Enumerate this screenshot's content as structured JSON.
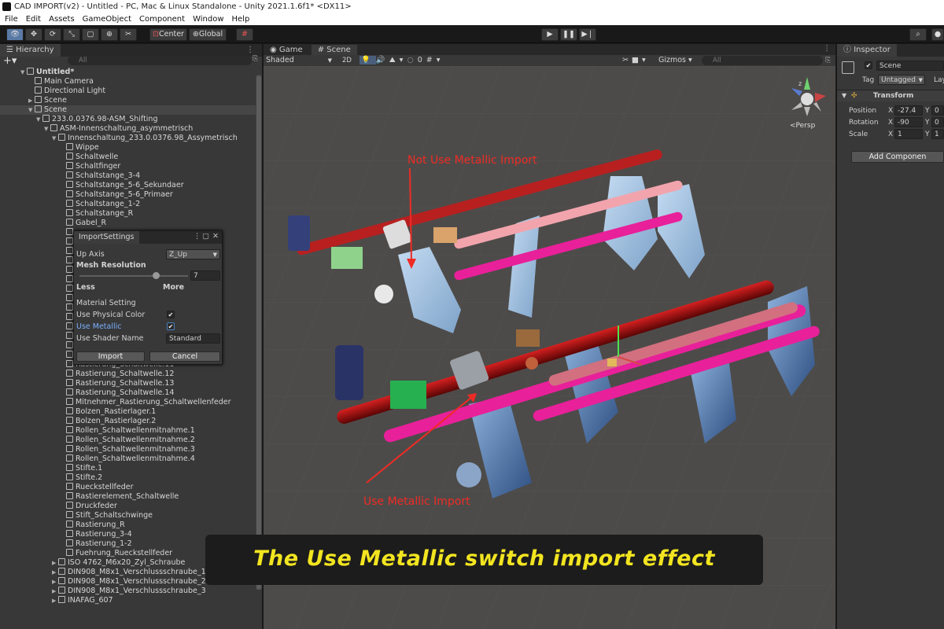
{
  "window": {
    "title": "CAD IMPORT(v2) - Untitled - PC, Mac & Linux Standalone - Unity 2021.1.6f1* <DX11>"
  },
  "menu": [
    "File",
    "Edit",
    "Assets",
    "GameObject",
    "Component",
    "Window",
    "Help"
  ],
  "toolbar": {
    "center_label": "Center",
    "global_label": "Global"
  },
  "hierarchy": {
    "tab": "Hierarchy",
    "search_placeholder": "All",
    "rows": [
      {
        "label": "Untitled*",
        "indent": 0,
        "arrow": "▼",
        "icon": false
      },
      {
        "label": "Main Camera",
        "indent": 1,
        "arrow": "",
        "icon": true
      },
      {
        "label": "Directional Light",
        "indent": 1,
        "arrow": "",
        "icon": true
      },
      {
        "label": "Scene",
        "indent": 1,
        "arrow": "▶",
        "icon": true
      },
      {
        "label": "Scene",
        "indent": 1,
        "arrow": "▼",
        "icon": true
      },
      {
        "label": "233.0.0376.98-ASM_Shifting",
        "indent": 2,
        "arrow": "▼",
        "icon": true
      },
      {
        "label": "ASM-Innenschaltung_asymmetrisch",
        "indent": 3,
        "arrow": "▼",
        "icon": true
      },
      {
        "label": "Innenschaltung_233.0.0376.98_Assymetrisch",
        "indent": 4,
        "arrow": "▼",
        "icon": true
      },
      {
        "label": "Wippe",
        "indent": 5,
        "arrow": "",
        "icon": true
      },
      {
        "label": "Schaltwelle",
        "indent": 5,
        "arrow": "",
        "icon": true
      },
      {
        "label": "Schaltfinger",
        "indent": 5,
        "arrow": "",
        "icon": true
      },
      {
        "label": "Schaltstange_3-4",
        "indent": 5,
        "arrow": "",
        "icon": true
      },
      {
        "label": "Schaltstange_5-6_Sekundaer",
        "indent": 5,
        "arrow": "",
        "icon": true
      },
      {
        "label": "Schaltstange_5-6_Primaer",
        "indent": 5,
        "arrow": "",
        "icon": true
      },
      {
        "label": "Schaltstange_1-2",
        "indent": 5,
        "arrow": "",
        "icon": true
      },
      {
        "label": "Schaltstange_R",
        "indent": 5,
        "arrow": "",
        "icon": true
      },
      {
        "label": "Gabel_R",
        "indent": 5,
        "arrow": "",
        "icon": true
      },
      {
        "label": "",
        "indent": 5,
        "arrow": "",
        "icon": true
      },
      {
        "label": "",
        "indent": 5,
        "arrow": "",
        "icon": true
      },
      {
        "label": "",
        "indent": 5,
        "arrow": "",
        "icon": true
      },
      {
        "label": "",
        "indent": 5,
        "arrow": "",
        "icon": true
      },
      {
        "label": "",
        "indent": 5,
        "arrow": "",
        "icon": true
      },
      {
        "label": "",
        "indent": 5,
        "arrow": "",
        "icon": true
      },
      {
        "label": "",
        "indent": 5,
        "arrow": "",
        "icon": true
      },
      {
        "label": "",
        "indent": 5,
        "arrow": "",
        "icon": true
      },
      {
        "label": "",
        "indent": 5,
        "arrow": "",
        "icon": true
      },
      {
        "label": "",
        "indent": 5,
        "arrow": "",
        "icon": true
      },
      {
        "label": "",
        "indent": 5,
        "arrow": "",
        "icon": true
      },
      {
        "label": "",
        "indent": 5,
        "arrow": "",
        "icon": true
      },
      {
        "label": "",
        "indent": 5,
        "arrow": "",
        "icon": true
      },
      {
        "label": "Rastierung_Schaltwelle.10",
        "indent": 5,
        "arrow": "",
        "icon": true
      },
      {
        "label": "Rastierung_Schaltwelle.11",
        "indent": 5,
        "arrow": "",
        "icon": true
      },
      {
        "label": "Rastierung_Schaltwelle.12",
        "indent": 5,
        "arrow": "",
        "icon": true
      },
      {
        "label": "Rastierung_Schaltwelle.13",
        "indent": 5,
        "arrow": "",
        "icon": true
      },
      {
        "label": "Rastierung_Schaltwelle.14",
        "indent": 5,
        "arrow": "",
        "icon": true
      },
      {
        "label": "Mitnehmer_Rastierung_Schaltwellenfeder",
        "indent": 5,
        "arrow": "",
        "icon": true
      },
      {
        "label": "Bolzen_Rastierlager.1",
        "indent": 5,
        "arrow": "",
        "icon": true
      },
      {
        "label": "Bolzen_Rastierlager.2",
        "indent": 5,
        "arrow": "",
        "icon": true
      },
      {
        "label": "Rollen_Schaltwellenmitnahme.1",
        "indent": 5,
        "arrow": "",
        "icon": true
      },
      {
        "label": "Rollen_Schaltwellenmitnahme.2",
        "indent": 5,
        "arrow": "",
        "icon": true
      },
      {
        "label": "Rollen_Schaltwellenmitnahme.3",
        "indent": 5,
        "arrow": "",
        "icon": true
      },
      {
        "label": "Rollen_Schaltwellenmitnahme.4",
        "indent": 5,
        "arrow": "",
        "icon": true
      },
      {
        "label": "Stifte.1",
        "indent": 5,
        "arrow": "",
        "icon": true
      },
      {
        "label": "Stifte.2",
        "indent": 5,
        "arrow": "",
        "icon": true
      },
      {
        "label": "Rueckstellfeder",
        "indent": 5,
        "arrow": "",
        "icon": true
      },
      {
        "label": "Rastierelement_Schaltwelle",
        "indent": 5,
        "arrow": "",
        "icon": true
      },
      {
        "label": "Druckfeder",
        "indent": 5,
        "arrow": "",
        "icon": true
      },
      {
        "label": "Stift_Schaltschwinge",
        "indent": 5,
        "arrow": "",
        "icon": true
      },
      {
        "label": "Rastierung_R",
        "indent": 5,
        "arrow": "",
        "icon": true
      },
      {
        "label": "Rastierung_3-4",
        "indent": 5,
        "arrow": "",
        "icon": true
      },
      {
        "label": "Rastierung_1-2",
        "indent": 5,
        "arrow": "",
        "icon": true
      },
      {
        "label": "Fuehrung_Rueckstellfeder",
        "indent": 5,
        "arrow": "",
        "icon": true
      },
      {
        "label": "ISO 4762_M6x20_Zyl_Schraube",
        "indent": 4,
        "arrow": "▶",
        "icon": true
      },
      {
        "label": "DIN908_M8x1_Verschlussschraube_1",
        "indent": 4,
        "arrow": "▶",
        "icon": true
      },
      {
        "label": "DIN908_M8x1_Verschlussschraube_2",
        "indent": 4,
        "arrow": "▶",
        "icon": true
      },
      {
        "label": "DIN908_M8x1_Verschlussschraube_3",
        "indent": 4,
        "arrow": "▶",
        "icon": true
      },
      {
        "label": "INAFAG_607",
        "indent": 4,
        "arrow": "▶",
        "icon": true
      }
    ]
  },
  "import_settings": {
    "title": "ImportSettings",
    "up_axis_label": "Up Axis",
    "up_axis_value": "Z_Up",
    "mesh_resolution_label": "Mesh Resolution",
    "mesh_resolution_value": "7",
    "mesh_resolution_fraction": 0.71,
    "less_label": "Less",
    "more_label": "More",
    "material_setting_label": "Material Setting",
    "use_physical_color_label": "Use Physical Color",
    "use_physical_color_checked": true,
    "use_metallic_label": "Use Metallic",
    "use_metallic_checked": true,
    "use_shader_name_label": "Use Shader Name",
    "shader_name_value": "Standard",
    "import_button": "Import",
    "cancel_button": "Cancel"
  },
  "scene_view": {
    "tabs": [
      "Game",
      "Scene"
    ],
    "shading_mode": "Shaded",
    "mode_2d": "2D",
    "gizmos_label": "Gizmos",
    "search_placeholder": "All",
    "persp_label": "<Persp",
    "label_top": "Not Use Metallic Import",
    "label_bottom": "Use Metallic Import",
    "caption": "The Use Metallic switch import effect"
  },
  "inspector": {
    "tab": "Inspector",
    "object_name": "Scene",
    "tag_label": "Tag",
    "tag_value": "Untagged",
    "layer_label_partial": "Lay",
    "transform_label": "Transform",
    "position_label": "Position",
    "rotation_label": "Rotation",
    "scale_label": "Scale",
    "position_x": "-27.4",
    "position_y": "0",
    "rotation_x": "-90",
    "rotation_y": "0",
    "scale_x": "1",
    "scale_y": "1",
    "x_axis": "X",
    "y_axis": "Y",
    "add_component_label": "Add Componen"
  },
  "colors": {
    "selection": "#5a7aa6",
    "annotation_red": "#ef2b25",
    "caption_yellow": "#f2e520",
    "rod_magenta": "#e8209a",
    "rod_red": "#a81010"
  }
}
